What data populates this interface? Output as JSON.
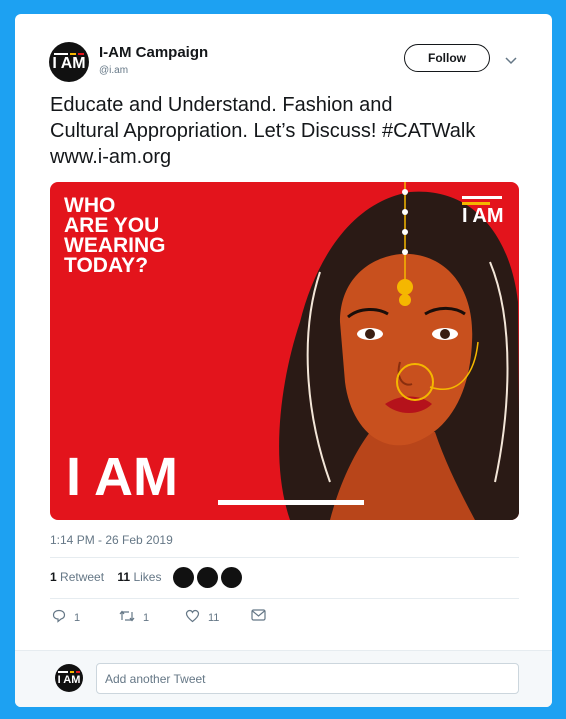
{
  "account": {
    "name": "I-AM Campaign",
    "handle": "@i.am",
    "avatar_text": "I AM"
  },
  "follow_label": "Follow",
  "tweet": {
    "lines": [
      "Educate and Understand. Fashion and",
      "Cultural Appropriation. Let’s Discuss! #CATWalk",
      "www.i-am.org"
    ]
  },
  "media": {
    "headline": [
      "WHO",
      "ARE YOU",
      "WEARING",
      "TODAY?"
    ],
    "big_text": "I AM",
    "logo_text": "I AM",
    "bg_color": "#e3141c",
    "logo_bar_colors": [
      "#ffffff",
      "#f5b700",
      "#e3141c"
    ]
  },
  "timestamp": "1:14 PM - 26 Feb 2019",
  "stats": {
    "retweets_count": "1",
    "retweets_label": "Retweet",
    "likes_count": "11",
    "likes_label": "Likes"
  },
  "actions": {
    "reply_count": "1",
    "retweet_count": "1",
    "like_count": "11"
  },
  "composer": {
    "placeholder": "Add another Tweet"
  }
}
